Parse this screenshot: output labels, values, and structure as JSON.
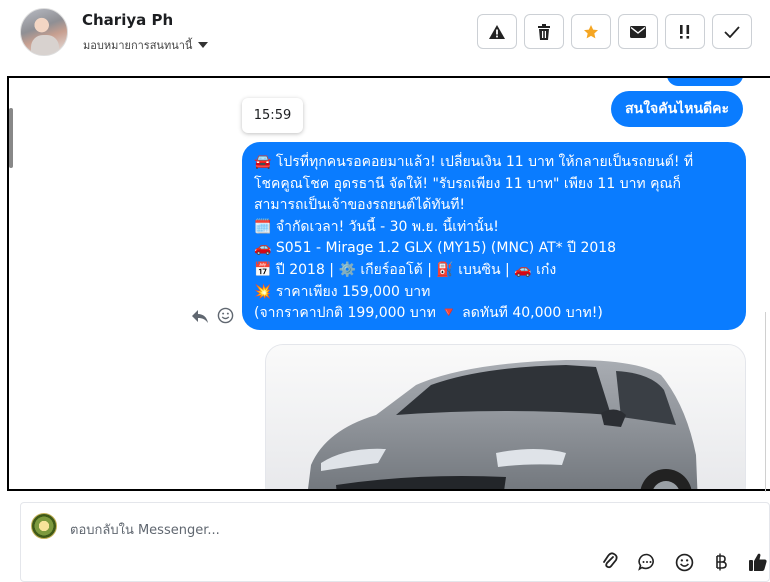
{
  "header": {
    "name": "Chariya Ph",
    "assign_label": "มอบหมายการสนทนานี้"
  },
  "conversation": {
    "question_bubble": "สนใจคันไหนดีคะ",
    "time_tooltip": "15:59",
    "message_lines": [
      "🚘 โปรที่ทุกคนรอคอยมาแล้ว! เปลี่ยนเงิน 11 บาท ให้กลายเป็นรถยนต์! ที่",
      "โชคคูณโชค อุดรธานี จัดให้! \"รับรถเพียง 11 บาท\" เพียง 11 บาท คุณก็",
      "สามารถเป็นเจ้าของรถยนต์ได้ทันที!",
      "🗓️ จำกัดเวลา! วันนี้ - 30 พ.ย. นี้เท่านั้น!",
      "🚗 S051 - Mirage 1.2 GLX (MY15) (MNC) AT* ปี 2018",
      "📅 ปี 2018 | ⚙️ เกียร์ออโต้ | ⛽ เบนซิน | 🚗 เก๋ง",
      "💥 ราคาเพียง 159,000 บาท",
      "(จากราคาปกติ 199,000 บาท 🔻 ลดทันที 40,000 บาท!)"
    ]
  },
  "composer": {
    "placeholder": "ตอบกลับใน Messenger..."
  },
  "colors": {
    "bubble_blue": "#0a7cff",
    "star_orange": "#f5a623"
  }
}
